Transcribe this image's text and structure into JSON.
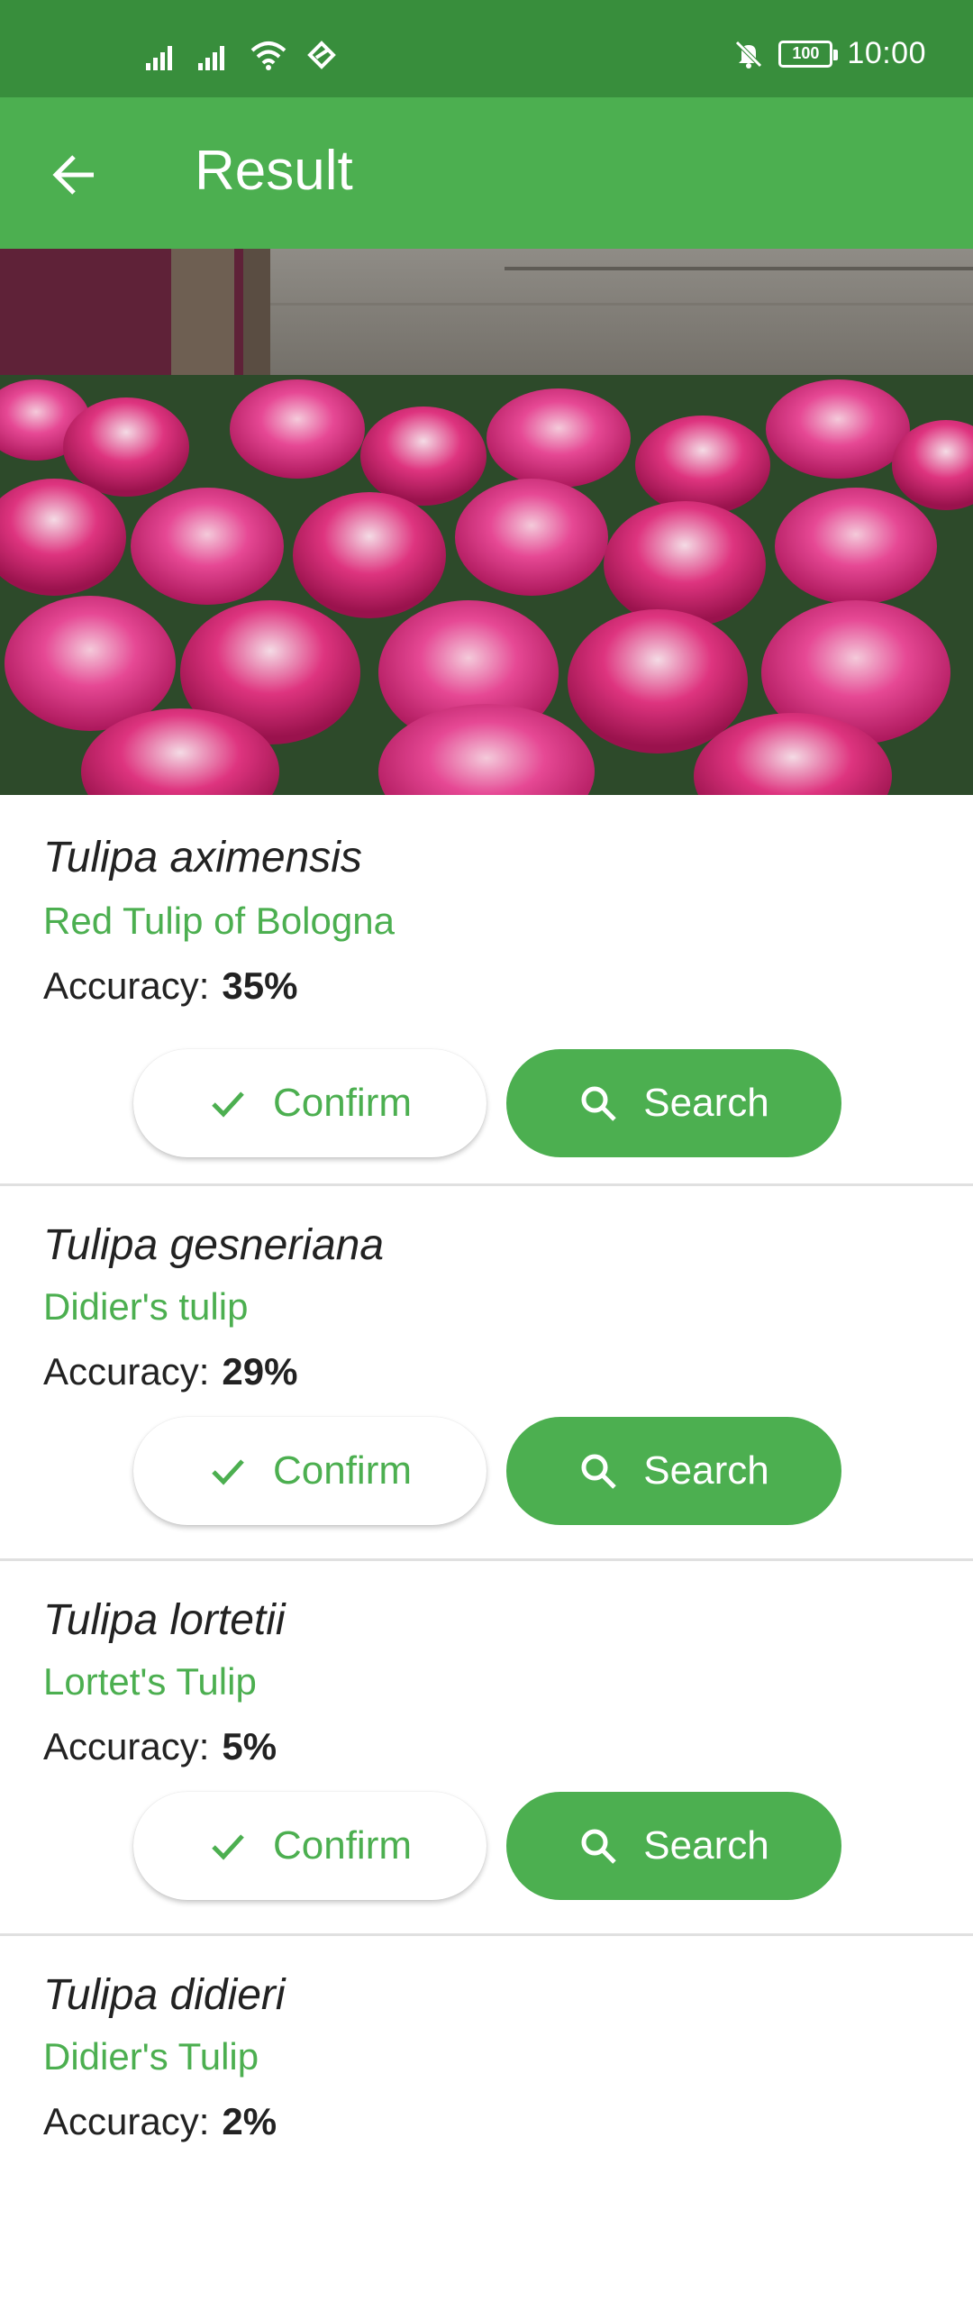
{
  "status_bar": {
    "time": "10:00",
    "battery": "100"
  },
  "app_bar": {
    "title": "Result"
  },
  "results": [
    {
      "scientific_name": "Tulipa aximensis",
      "common_name": "Red Tulip of Bologna",
      "accuracy_label": "Accuracy:",
      "accuracy_value": "35%",
      "confirm_label": "Confirm",
      "search_label": "Search"
    },
    {
      "scientific_name": "Tulipa gesneriana",
      "common_name": "Didier's tulip",
      "accuracy_label": "Accuracy:",
      "accuracy_value": "29%",
      "confirm_label": "Confirm",
      "search_label": "Search"
    },
    {
      "scientific_name": "Tulipa lortetii",
      "common_name": "Lortet's Tulip",
      "accuracy_label": "Accuracy:",
      "accuracy_value": "5%",
      "confirm_label": "Confirm",
      "search_label": "Search"
    },
    {
      "scientific_name": "Tulipa didieri",
      "common_name": "Didier's Tulip",
      "accuracy_label": "Accuracy:",
      "accuracy_value": "2%"
    }
  ],
  "colors": {
    "primary": "#4caf50",
    "primary_dark": "#388e3c",
    "text": "#222222"
  },
  "icons": [
    "signal-icon",
    "wifi-icon",
    "data-saver-icon",
    "mute-icon",
    "battery-icon",
    "back-arrow-icon",
    "check-icon",
    "search-icon"
  ]
}
